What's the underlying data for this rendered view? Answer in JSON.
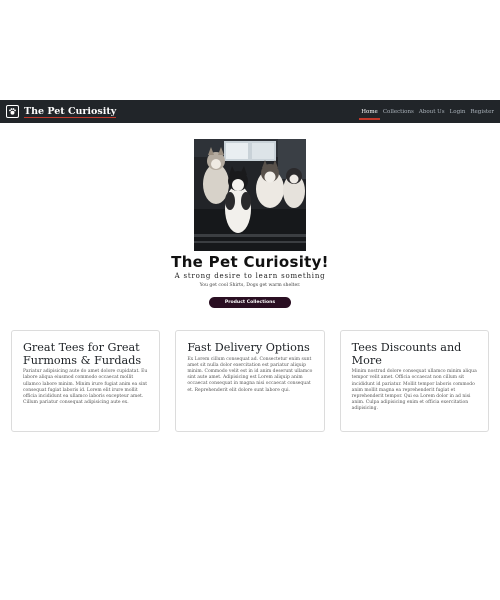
{
  "navbar": {
    "brand": "The Pet Curiosity",
    "links": [
      "Home",
      "Collections",
      "About Us",
      "Login",
      "Register"
    ]
  },
  "hero": {
    "title": "The Pet Curiosity!",
    "subtitle": "A strong desire to learn something",
    "text": "You get cool Shirts, Dogs get warm shelter.",
    "button": "Product Collections"
  },
  "cards": [
    {
      "title": "Great Tees for Great Furmoms & Furdads",
      "text": "Pariatur adipisicing aute do amet dolore cupidatat. Eu labore aliqua eiusmod commodo occaecat mollit ullamco labore minim. Minim irure fugiat anim ea sint consequat fugiat laboris id. Lorem elit irure mollit officia incididunt ea ullamco laboris excepteur amet. Cillum pariatur consequat adipisicing aute ex."
    },
    {
      "title": "Fast Delivery Options",
      "text": "Ex Lorem cillum consequat ad. Consectetur enim sunt amet sit nulla dolor exercitation est pariatur aliquip minim. Commodo velit est in id anim deserunt ullamco sint aute amet. Adipisicing est Lorem aliquip anim occaecat consequat in magna nisi occaecat consequat et. Reprehenderit elit dolore sunt labore qui."
    },
    {
      "title": "Tees Discounts and More",
      "text": "Minim nostrud dolore consequat ullamco minim aliqua tempor velit amet. Officia occaecat non cillum sit incididunt id pariatur. Mollit tempor laboris commodo anim mollit magna ea reprehenderit fugiat et reprehenderit tempor. Qui ea Lorem dolor in ad nisi anim. Culpa adipisicing enim et officia exercitation adipisicing."
    }
  ]
}
